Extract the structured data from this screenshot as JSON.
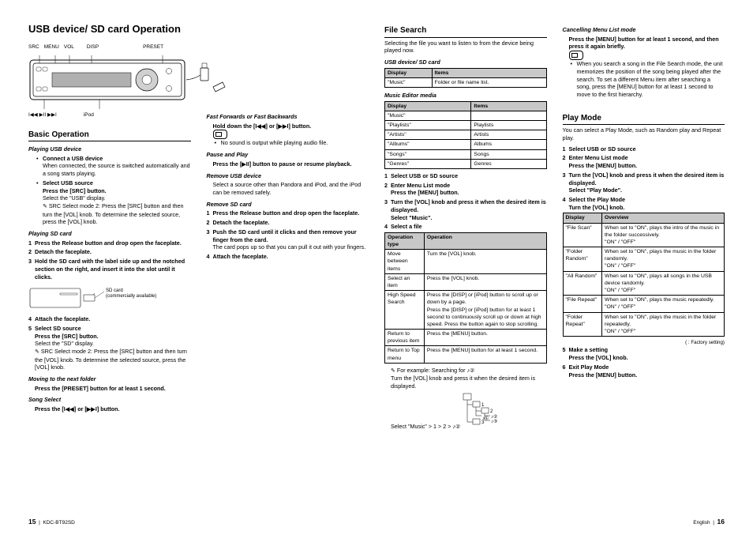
{
  "title": "USB device/ SD card Operation",
  "diagram": {
    "topLabels": [
      "SRC",
      "MENU",
      "VOL",
      "DISP",
      "PRESET"
    ],
    "bottomLabels": [
      "I◀◀ ▶II ▶▶I",
      "iPod"
    ]
  },
  "basic": {
    "heading": "Basic Operation",
    "playUsb": {
      "h": "Playing USB device",
      "b1t": "Connect a USB device",
      "b1d": "When connected, the source is switched automatically and a song starts playing.",
      "b2t": "Select USB source",
      "b2l1": "Press the [SRC] button.",
      "b2l2": "Select the \"USB\" display.",
      "b2l3": "SRC Select mode 2: Press the [SRC] button and then turn the [VOL] knob. To determine the selected source, press the [VOL] knob."
    },
    "playSd": {
      "h": "Playing SD card",
      "s1": "Press the Release button and drop open the faceplate.",
      "s2": "Detach the faceplate.",
      "s3": "Hold the SD card with the label side up and the notched section on the right, and insert it into the slot until it clicks.",
      "sdNote": "SD card\n(commercially available)",
      "s4": "Attach the faceplate.",
      "s5t": "Select SD source",
      "s5l1": "Press the [SRC] button.",
      "s5l2": "Select the \"SD\" display.",
      "s5l3": "SRC Select mode 2: Press the [SRC] button and then turn the [VOL] knob. To determine the selected source, press the [VOL] knob."
    },
    "nextFolder": {
      "h": "Moving to the next folder",
      "t": "Press the [PRESET] button for at least 1 second."
    },
    "songSelect": {
      "h": "Song Select",
      "t": "Press the [I◀◀] or [▶▶I] button."
    }
  },
  "col2": {
    "ff": {
      "h": "Fast Forwards or Fast Backwards",
      "t": "Hold down the [I◀◀] or [▶▶I] button.",
      "n": "No sound is output while playing audio file."
    },
    "pause": {
      "h": "Pause and Play",
      "t": "Press the [▶II] button to pause or resume playback."
    },
    "removeUsb": {
      "h": "Remove USB device",
      "t": "Select a source other than Pandora and iPod, and the iPod can be removed safely."
    },
    "removeSd": {
      "h": "Remove SD card",
      "s1": "Press the Release button and drop open the faceplate.",
      "s2": "Detach the faceplate.",
      "s3t": "Push the SD card until it clicks and then remove your finger from the card.",
      "s3d": "The card pops up so that you can pull it out with your fingers.",
      "s4": "Attach the faceplate."
    }
  },
  "fileSearch": {
    "heading": "File Search",
    "intro": "Selecting the file you want to listen to from the device being played now.",
    "usbH": "USB device/ SD card",
    "table1": {
      "headers": [
        "Display",
        "Items"
      ],
      "rows": [
        [
          "\"Music\"",
          "Folder or file name list."
        ]
      ]
    },
    "medH": "Music Editor media",
    "table2": {
      "headers": [
        "Display",
        "Items"
      ],
      "rows": [
        [
          "\"Music\"",
          ""
        ],
        [
          "  \"Playlists\"",
          "Playlists"
        ],
        [
          "  \"Artists\"",
          "Artists"
        ],
        [
          "  \"Albums\"",
          "Albums"
        ],
        [
          "  \"Songs\"",
          "Songs"
        ],
        [
          "  \"Genres\"",
          "Genres"
        ]
      ]
    },
    "s1": "Select USB or SD source",
    "s2": "Enter Menu List mode",
    "s2d": "Press the [MENU] button.",
    "s3": "Turn the [VOL] knob and press it when the desired item is displayed.",
    "s3d": "Select \"Music\".",
    "s4": "Select a file",
    "table3": {
      "headers": [
        "Operation type",
        "Operation"
      ],
      "rows": [
        [
          "Move between items",
          "Turn the [VOL] knob."
        ],
        [
          "Select an item",
          "Press the [VOL] knob."
        ],
        [
          "High Speed Search",
          "Press the [DISP] or [iPod] button to scroll up or down by a page.\nPress the [DISP] or [iPod] button for at least 1 second to continuously scroll up or down at high speed. Press the button again to stop scrolling."
        ],
        [
          "Return to previous item",
          "Press the [MENU] button."
        ],
        [
          "Return to Top menu",
          "Press the [MENU] button for at least 1 second."
        ]
      ]
    },
    "example": {
      "lead": "For example: Searching for ♪②",
      "l1": "Turn the [VOL] knob and press it when the desired item is displayed.",
      "l2": "Select \"Music\" > 1 > 2 > ♪②"
    }
  },
  "cancel": {
    "h": "Cancelling Menu List mode",
    "t": "Press the [MENU] button for at least 1 second, and then press it again briefly.",
    "n": "When you search a song in the File Search mode, the unit memorizes the position of the song being played after the search. To set a different Menu item after searching a song, press the [MENU] button for at least 1 second to move to the first hierarchy."
  },
  "playMode": {
    "heading": "Play Mode",
    "intro": "You can select a Play Mode, such as Random play and Repeat play.",
    "s1": "Select USB or SD source",
    "s2": "Enter Menu List mode",
    "s2d": "Press the [MENU] button.",
    "s3": "Turn the [VOL] knob and press it when the desired item is displayed.",
    "s3d": "Select \"Play Mode\".",
    "s4": "Select the Play Mode",
    "s4d": "Turn the [VOL] knob.",
    "table": {
      "headers": [
        "Display",
        "Overview"
      ],
      "rows": [
        [
          "\"File Scan\"",
          "When set to \"ON\", plays the intro of the music in the folder successively.\n\"ON\" / \"OFF\""
        ],
        [
          "\"Folder Random\"",
          "When set to \"ON\", plays the music in the folder randomly.\n\"ON\" / \"OFF\""
        ],
        [
          "\"All Random\"",
          "When set to \"ON\", plays all songs in the USB device randomly.\n\"ON\" / \"OFF\""
        ],
        [
          "\"File Repeat\"",
          "When set to \"ON\", plays the music repeatedly.\n\"ON\" / \"OFF\""
        ],
        [
          "\"Folder Repeat\"",
          "When set to \"ON\", plays the music in the folder repeatedly.\n\"ON\" / \"OFF\""
        ]
      ]
    },
    "factory": "(      : Factory setting)",
    "s5": "Make a setting",
    "s5d": "Press the [VOL] knob.",
    "s6": "Exit Play Mode",
    "s6d": "Press the [MENU] button."
  },
  "footer": {
    "leftPage": "15",
    "leftModel": "KDC-BT92SD",
    "rightLang": "English",
    "rightPage": "16"
  }
}
